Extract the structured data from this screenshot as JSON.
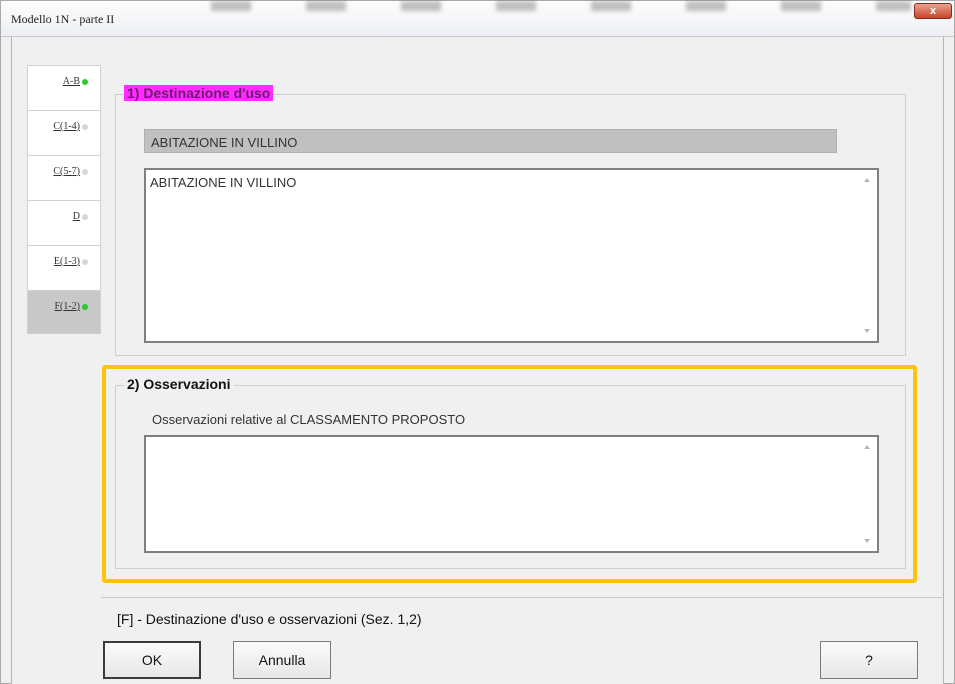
{
  "window": {
    "title": "Modello 1N -  parte II",
    "close_label": "x"
  },
  "tabs": [
    {
      "label": "A-B",
      "status_color": "#2cc92c",
      "selected": false
    },
    {
      "label": "C(1-4)",
      "status_color": "#d6d6d6",
      "selected": false
    },
    {
      "label": "C(5-7)",
      "status_color": "#d6d6d6",
      "selected": false
    },
    {
      "label": "D",
      "status_color": "#d6d6d6",
      "selected": false
    },
    {
      "label": "E(1-3)",
      "status_color": "#d6d6d6",
      "selected": false
    },
    {
      "label": "F(1-2)",
      "status_color": "#2cc92c",
      "selected": true
    }
  ],
  "section1": {
    "legend": "1) Destinazione d'uso",
    "selected_value": "ABITAZIONE IN VILLINO",
    "text_value": "ABITAZIONE IN VILLINO"
  },
  "section2": {
    "legend": "2) Osservazioni",
    "label": "Osservazioni relative al CLASSAMENTO PROPOSTO",
    "text_value": ""
  },
  "footer": {
    "description": "[F] - Destinazione d'uso e osservazioni (Sez. 1,2)"
  },
  "buttons": {
    "ok": "OK",
    "cancel": "Annulla",
    "help": "?"
  },
  "colors": {
    "highlight": "#ffc20e",
    "legend_highlight": "#ff2bff",
    "status_ok": "#2cc92c"
  }
}
